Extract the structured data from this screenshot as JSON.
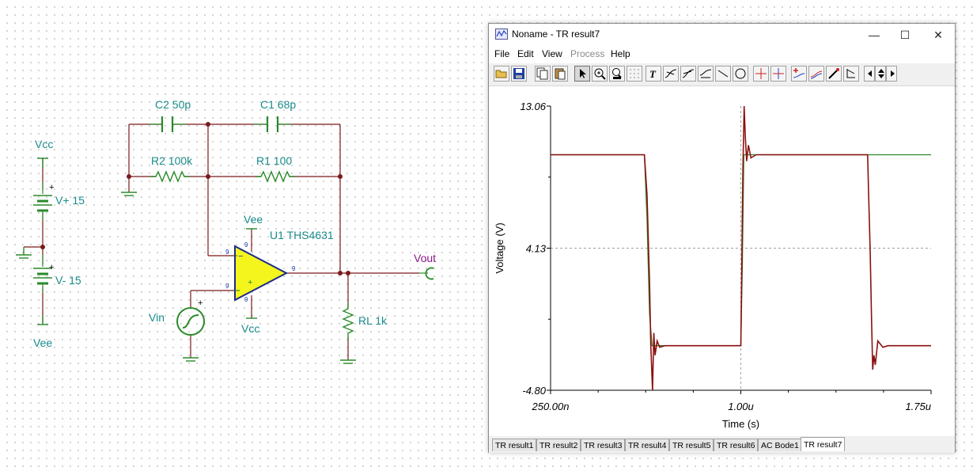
{
  "schematic": {
    "vcc_top_label": "Vcc",
    "vee_bottom_label": "Vee",
    "vplus_label": "V+ 15",
    "vminus_label": "V- 15",
    "c2_label": "C2 50p",
    "c1_label": "C1 68p",
    "r2_label": "R2 100k",
    "r1_label": "R1 100",
    "opamp_vee_label": "Vee",
    "opamp_label": "U1 THS4631",
    "opamp_vcc_label": "Vcc",
    "vin_label": "Vin",
    "vout_label": "Vout",
    "rl_label": "RL 1k",
    "pin_number": "9",
    "minus_sign": "−",
    "plus_sign": "+"
  },
  "grapher": {
    "title": "Noname - TR result7",
    "window_buttons": {
      "minimize": "—",
      "maximize": "☐",
      "close": "✕"
    },
    "menu": [
      "File",
      "Edit",
      "View",
      "Process",
      "Help"
    ],
    "toolbar_icons": [
      "open-icon",
      "save-icon",
      "copy-icon",
      "paste-icon",
      "pointer-icon",
      "zoom-in-icon",
      "zoom-100-icon",
      "grid-icon",
      "text-icon",
      "curve-label-icon",
      "curve-label2-icon",
      "curve-label3-icon",
      "line-icon",
      "circle-icon",
      "cursor-a-icon",
      "cursor-b-icon",
      "add-curve-icon",
      "curves-icon",
      "probe-icon",
      "step-icon",
      "arrow-left-icon",
      "arrow-updown-icon",
      "arrow-right-icon"
    ],
    "tabs": [
      "TR result1",
      "TR result2",
      "TR result3",
      "TR result4",
      "TR result5",
      "TR result6",
      "AC Bode1",
      "TR result7"
    ],
    "active_tab": "TR result7"
  },
  "chart_data": {
    "type": "line",
    "title": "",
    "xlabel": "Time (s)",
    "ylabel": "Voltage (V)",
    "x_tick_labels": [
      "250.00n",
      "1.00u",
      "1.75u"
    ],
    "y_tick_labels": [
      "13.06",
      "4.13",
      "-4.80"
    ],
    "xlim": [
      2.5e-07,
      1.75e-06
    ],
    "ylim": [
      -4.8,
      13.06
    ],
    "grid": "dashed at 4.13 V and 1.00 us",
    "series": [
      {
        "color": "#2a8a2a",
        "points": [
          [
            2.5e-07,
            10
          ],
          [
            6.2e-07,
            10
          ],
          [
            6.3e-07,
            6
          ],
          [
            6.4e-07,
            0
          ],
          [
            6.5e-07,
            -2
          ],
          [
            1e-06,
            -2
          ],
          [
            1.006e-06,
            3
          ],
          [
            1.012e-06,
            10
          ],
          [
            1.75e-06,
            10
          ]
        ]
      },
      {
        "color": "#8b1010",
        "points": [
          [
            2.5e-07,
            10
          ],
          [
            6.2e-07,
            10
          ],
          [
            6.3e-07,
            7.5
          ],
          [
            6.4e-07,
            2
          ],
          [
            6.45e-07,
            -2
          ],
          [
            6.52e-07,
            -4.8
          ],
          [
            6.57e-07,
            -1.2
          ],
          [
            6.62e-07,
            -2.6
          ],
          [
            6.7e-07,
            -1.7
          ],
          [
            6.8e-07,
            -2.1
          ],
          [
            7e-07,
            -2
          ],
          [
            1e-06,
            -2
          ],
          [
            1.003e-06,
            2
          ],
          [
            1.008e-06,
            9
          ],
          [
            1.013e-06,
            13.06
          ],
          [
            1.018e-06,
            11
          ],
          [
            1.023e-06,
            9.6
          ],
          [
            1.03e-06,
            10.6
          ],
          [
            1.04e-06,
            9.8
          ],
          [
            1.06e-06,
            10
          ],
          [
            1.5e-06,
            10
          ],
          [
            1.503e-06,
            8
          ],
          [
            1.51e-06,
            4
          ],
          [
            1.515e-06,
            0
          ],
          [
            1.52e-06,
            -3.5
          ],
          [
            1.525e-06,
            -2.6
          ],
          [
            1.53e-06,
            -3.2
          ],
          [
            1.54e-06,
            -1.7
          ],
          [
            1.56e-06,
            -2.1
          ],
          [
            1.58e-06,
            -2
          ],
          [
            1.75e-06,
            -2
          ]
        ]
      }
    ]
  }
}
